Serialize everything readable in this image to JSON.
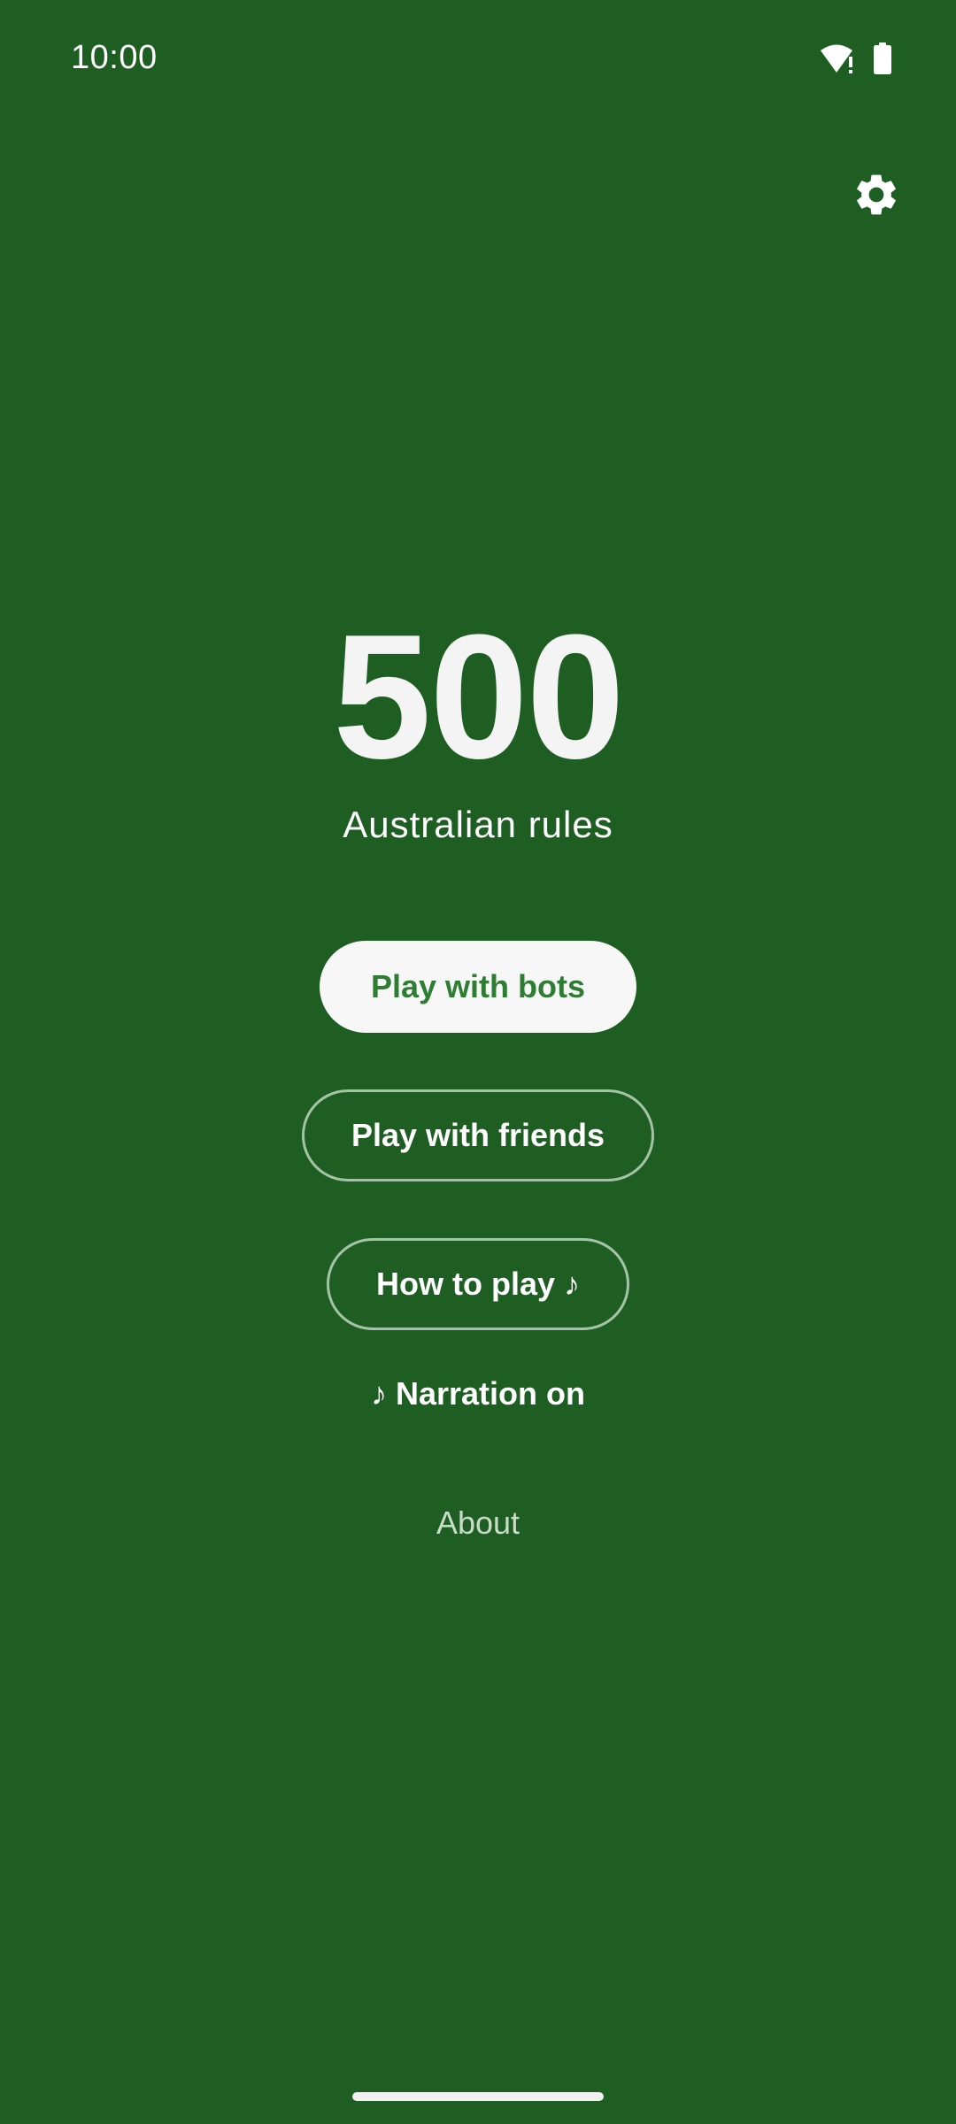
{
  "status_bar": {
    "time": "10:00",
    "icons": [
      "wifi-alert-icon",
      "battery-icon"
    ]
  },
  "header": {
    "settings_icon": "gear-icon"
  },
  "main": {
    "title": "500",
    "subtitle": "Australian rules",
    "buttons": {
      "play_bots": "Play with bots",
      "play_friends": "Play with friends",
      "how_to_play": "How to play ♪"
    },
    "narration": "♪ Narration on",
    "about": "About"
  },
  "colors": {
    "background": "#1e5e22",
    "primary_button_bg": "#f7f7f7",
    "primary_button_text": "#2e7d32",
    "outline_border": "#a5c3a6",
    "about_text": "#c8dcc8"
  }
}
